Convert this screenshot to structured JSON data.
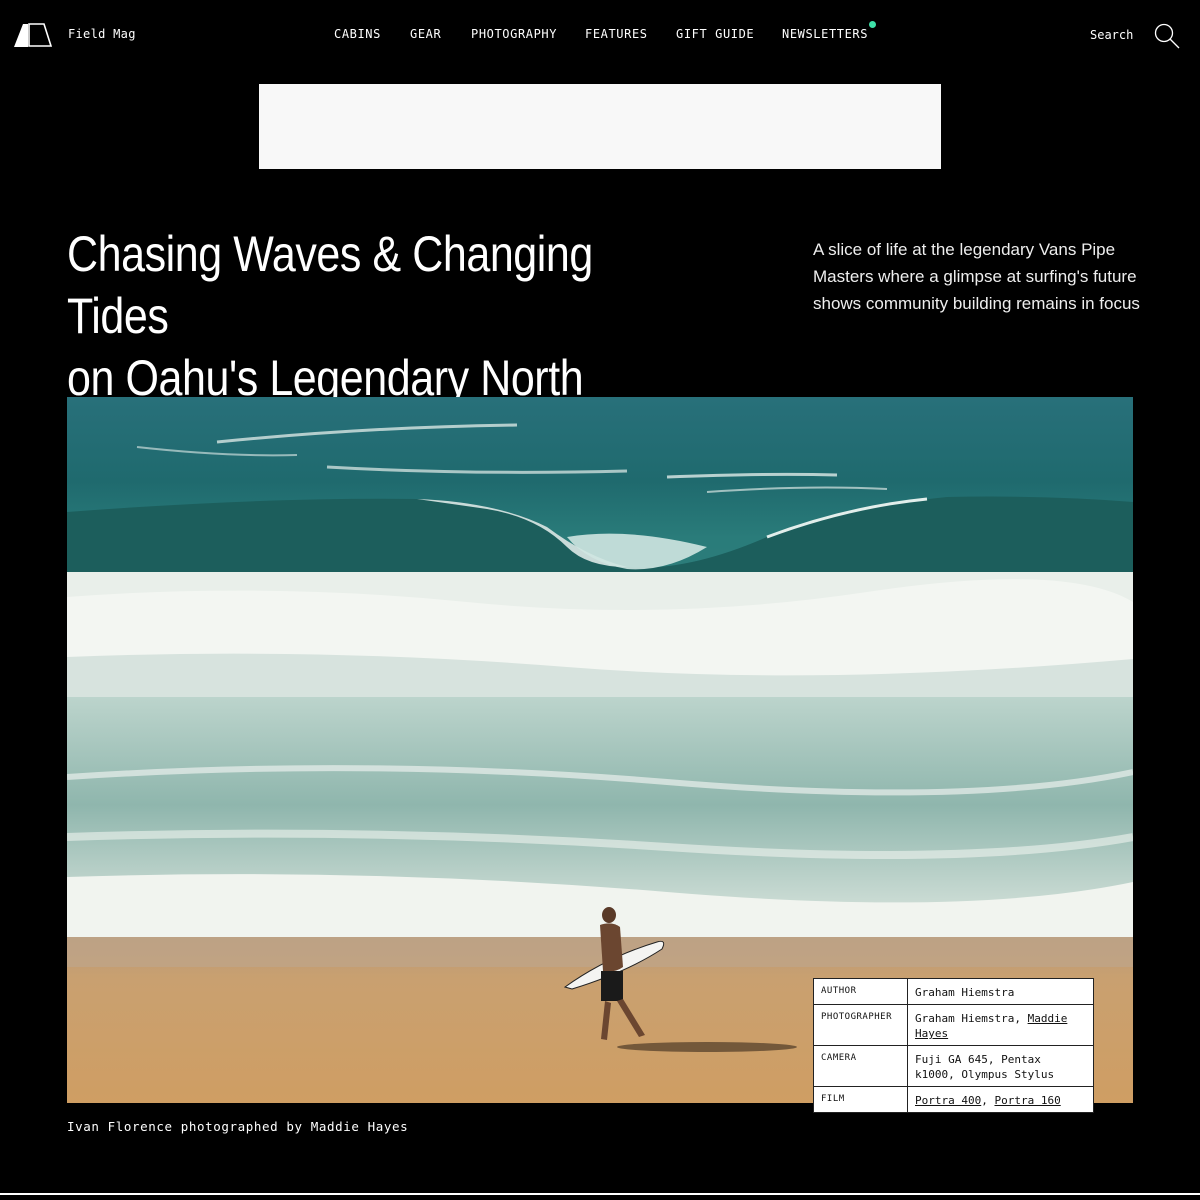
{
  "header": {
    "brand": "Field Mag",
    "nav": [
      {
        "label": "CABINS",
        "has_dot": false
      },
      {
        "label": "GEAR",
        "has_dot": false
      },
      {
        "label": "PHOTOGRAPHY",
        "has_dot": false
      },
      {
        "label": "FEATURES",
        "has_dot": false
      },
      {
        "label": "GIFT GUIDE",
        "has_dot": false
      },
      {
        "label": "NEWSLETTERS",
        "has_dot": true
      }
    ],
    "search_label": "Search",
    "dot_color": "#3ee0a8"
  },
  "article": {
    "title_line1": "Chasing Waves & Changing Tides",
    "title_line2": "on Oahu's Legendary North Shore",
    "dek": "A slice of life at the legendary Vans Pipe Masters where a glimpse at surfing's future shows community building remains in focus",
    "caption": "Ivan Florence photographed by Maddie Hayes"
  },
  "meta": {
    "author_label": "AUTHOR",
    "author": "Graham Hiemstra",
    "photographer_label": "PHOTOGRAPHER",
    "photographer_plain": "Graham Hiemstra, ",
    "photographer_link": "Maddie Hayes",
    "camera_label": "CAMERA",
    "camera": "Fuji GA 645, Pentax k1000, Olympus Stylus",
    "film_label": "FILM",
    "film_link1": "Portra 400",
    "film_sep": ", ",
    "film_link2": "Portra 160"
  },
  "colors": {
    "background": "#000000",
    "ocean": "#1f6f6c",
    "sand": "#c99a66"
  }
}
